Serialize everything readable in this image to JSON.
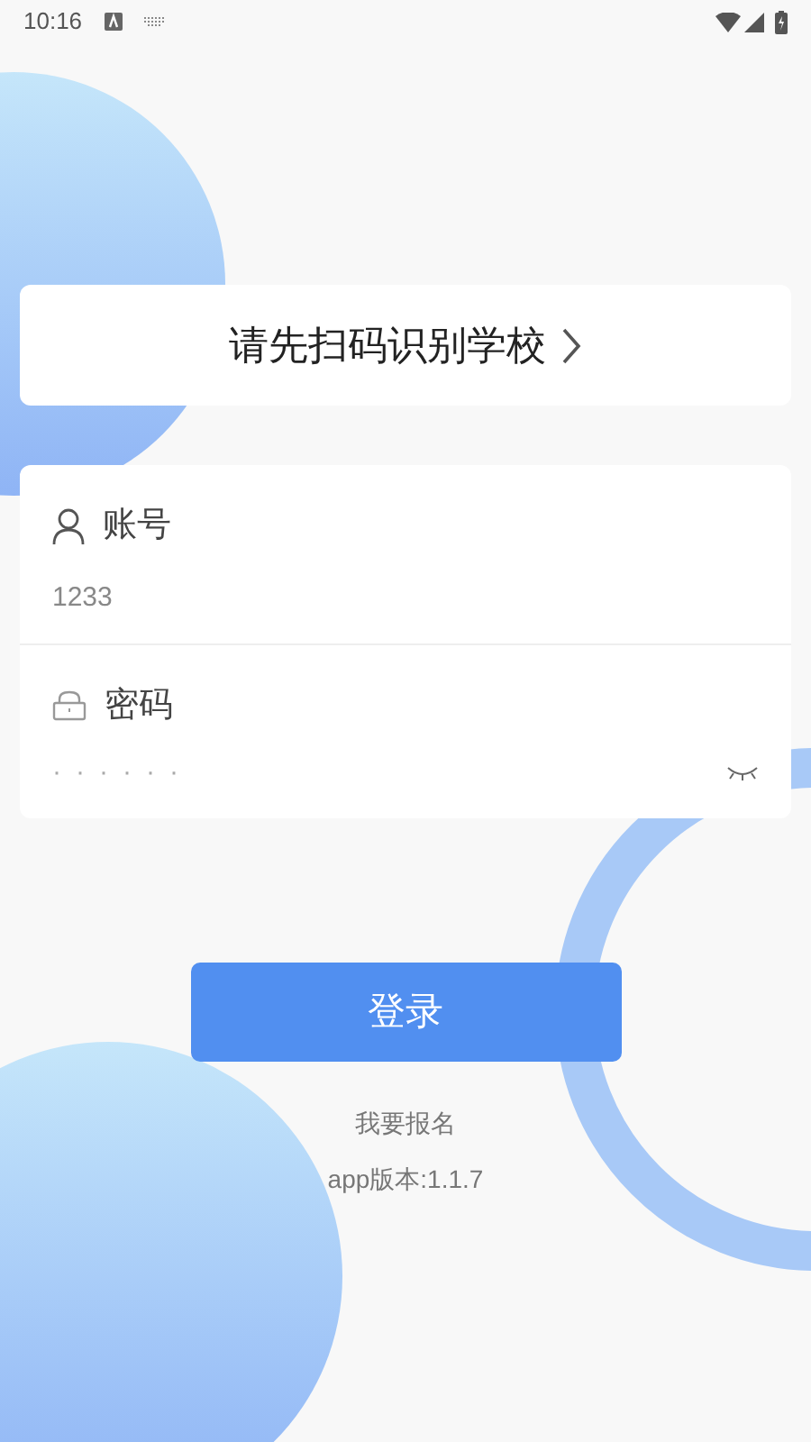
{
  "status_bar": {
    "time": "10:16"
  },
  "school_selector": {
    "label": "请先扫码识别学校"
  },
  "account": {
    "label": "账号",
    "value": "1233"
  },
  "password": {
    "label": "密码",
    "value": "······",
    "visible": false
  },
  "login_button": {
    "label": "登录"
  },
  "signup_link": {
    "label": "我要报名"
  },
  "version": {
    "label": "app版本:1.1.7"
  }
}
